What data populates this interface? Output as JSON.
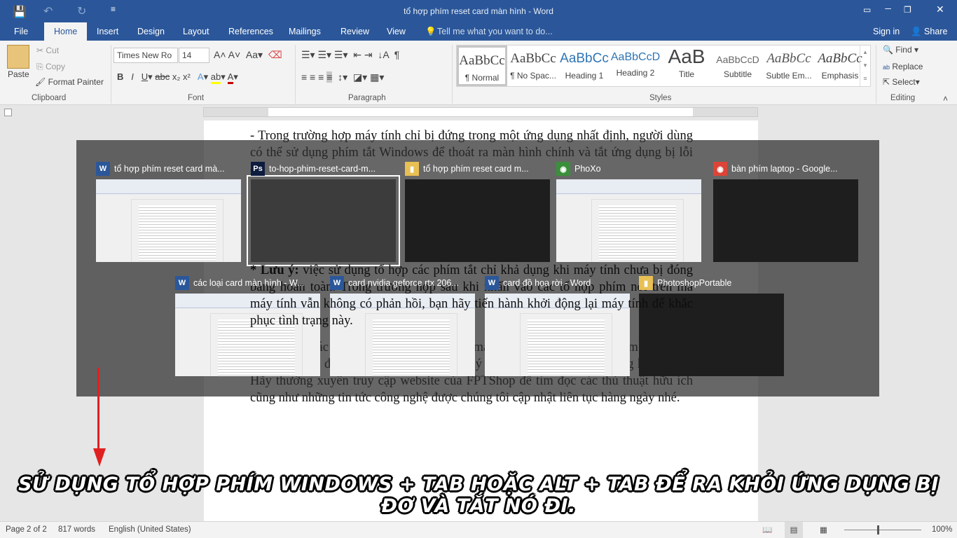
{
  "window": {
    "title": "tổ hợp phím reset card màn hình - Word",
    "signin": "Sign in",
    "share": "Share"
  },
  "tabs": [
    "File",
    "Home",
    "Insert",
    "Design",
    "Layout",
    "References",
    "Mailings",
    "Review",
    "View"
  ],
  "tell_me": "Tell me what you want to do...",
  "clipboard": {
    "paste": "Paste",
    "cut": "Cut",
    "copy": "Copy",
    "format_painter": "Format Painter",
    "group": "Clipboard"
  },
  "font": {
    "name": "Times New Ro",
    "size": "14",
    "group": "Font"
  },
  "paragraph": {
    "group": "Paragraph"
  },
  "styles": {
    "group": "Styles",
    "items": [
      {
        "preview": "AaBbCc",
        "name": "¶ Normal"
      },
      {
        "preview": "AaBbCc",
        "name": "¶ No Spac..."
      },
      {
        "preview": "AaBbCc",
        "name": "Heading 1"
      },
      {
        "preview": "AaBbCcD",
        "name": "Heading 2"
      },
      {
        "preview": "AaB",
        "name": "Title"
      },
      {
        "preview": "AaBbCcD",
        "name": "Subtitle"
      },
      {
        "preview": "AaBbCc",
        "name": "Subtle Em..."
      },
      {
        "preview": "AaBbCc",
        "name": "Emphasis"
      }
    ]
  },
  "editing": {
    "find": "Find",
    "replace": "Replace",
    "select": "Select",
    "group": "Editing"
  },
  "document": {
    "p1": "- Trong trường hợp máy tính chỉ bị đứng trong một ứng dụng nhất định, người dùng có thể sử dụng phím tắt Windows để thoát ra màn hình chính và tắt ứng dụng bị lỗi đi.",
    "note_label": "* Lưu ý:",
    "note": " việc sử dụng tổ hợp các phím tắt chỉ khả dụng khi máy tính chưa bị đóng băng hoàn toàn. Trong trường hợp sau khi nhấn vào các tổ hợp phím nói trên mà máy tính vẫn không có phản hồi, bạn hãy tiến hành khởi động lại máy tính để khắc phục tình trạng này.",
    "p2": "Như vậy là các bạn đã biết cách reset card màn hình bằng tổ hợp các phím tắt cực kỳ nhanh chóng, đơn giản cũng như cách xử lý khi máy tính của bạn ngưng hoạt động. Hãy thường xuyên truy cập website của FPTShop để tìm đọc các thủ thuật hữu ích cũng như những tin tức công nghệ được chúng tôi cập nhật liên tục hàng ngày nhé."
  },
  "switcher": {
    "windows": [
      {
        "title": "tổ hợp phím reset card mà...",
        "app": "word"
      },
      {
        "title": "to-hop-phim-reset-card-m...",
        "app": "photoshop",
        "selected": true
      },
      {
        "title": "tổ hợp phím reset card m...",
        "app": "explorer"
      },
      {
        "title": "PhoXo",
        "app": "phoxo"
      },
      {
        "title": "bàn phím laptop - Google...",
        "app": "chrome"
      },
      {
        "title": "các loại card màn hình - W...",
        "app": "word"
      },
      {
        "title": "card nvidia geforce rtx 206...",
        "app": "word"
      },
      {
        "title": "card đồ họa rời - Word",
        "app": "word"
      },
      {
        "title": "PhotoshopPortable",
        "app": "explorer"
      }
    ]
  },
  "caption": "Sử dụng tổ hợp phím Windows + Tab hoặc Alt + Tab để ra khỏi ứng dụng bị đơ và tắt nó đi.",
  "status": {
    "page": "Page 2 of 2",
    "words": "817 words",
    "language": "English (United States)",
    "zoom": "100%"
  },
  "colors": {
    "word_blue": "#2b579a",
    "arrow": "#e02020"
  }
}
